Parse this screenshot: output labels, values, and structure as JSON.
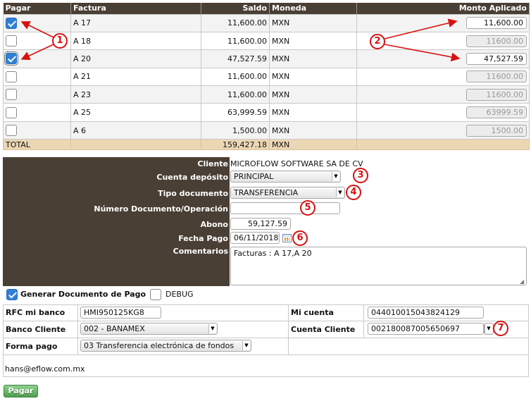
{
  "table": {
    "headers": {
      "pay": "Pagar",
      "invoice": "Factura",
      "balance": "Saldo",
      "currency": "Moneda",
      "amount": "Monto Aplicado"
    },
    "rows": [
      {
        "checked": true,
        "invoice": "A 17",
        "balance": "11,600.00",
        "currency": "MXN",
        "amount": "11,600.00",
        "enabled": true
      },
      {
        "checked": false,
        "invoice": "A 18",
        "balance": "11,600.00",
        "currency": "MXN",
        "amount": "11600.00",
        "enabled": false
      },
      {
        "checked": true,
        "invoice": "A 20",
        "balance": "47,527.59",
        "currency": "MXN",
        "amount": "47,527.59",
        "enabled": true
      },
      {
        "checked": false,
        "invoice": "A 21",
        "balance": "11,600.00",
        "currency": "MXN",
        "amount": "11600.00",
        "enabled": false
      },
      {
        "checked": false,
        "invoice": "A 23",
        "balance": "11,600.00",
        "currency": "MXN",
        "amount": "11600.00",
        "enabled": false
      },
      {
        "checked": false,
        "invoice": "A 25",
        "balance": "63,999.59",
        "currency": "MXN",
        "amount": "63999.59",
        "enabled": false
      },
      {
        "checked": false,
        "invoice": "A 6",
        "balance": "1,500.00",
        "currency": "MXN",
        "amount": "1500.00",
        "enabled": false
      }
    ],
    "total": {
      "label": "TOTAL",
      "balance": "159,427.18",
      "currency": "MXN"
    }
  },
  "form": {
    "client_label": "Cliente",
    "client_value": "MICROFLOW SOFTWARE SA DE CV",
    "deposit_account_label": "Cuenta depósito",
    "deposit_account_value": "PRINCIPAL",
    "doc_type_label": "Tipo documento",
    "doc_type_value": "TRANSFERENCIA",
    "doc_number_label": "Número Documento/Operación",
    "doc_number_value": "",
    "payment_label": "Abono",
    "payment_value": "59,127.59",
    "pay_date_label": "Fecha Pago",
    "pay_date_value": "06/11/2018",
    "comments_label": "Comentarios",
    "comments_value": "Facturas : A 17,A 20"
  },
  "options": {
    "generate_doc_label": "Generar Documento de Pago",
    "generate_doc_checked": true,
    "debug_label": "DEBUG",
    "debug_checked": false
  },
  "bank": {
    "rfc_label": "RFC mi banco",
    "rfc_value": "HMI950125KG8",
    "my_account_label": "Mi cuenta",
    "my_account_value": "044010015043824129",
    "client_bank_label": "Banco Cliente",
    "client_bank_value": "002 - BANAMEX",
    "client_account_label": "Cuenta Cliente",
    "client_account_value": "002180087005650697",
    "payment_method_label": "Forma pago",
    "payment_method_value": "03 Transferencia electrónica de fondos",
    "email": "hans@eflow.com.mx"
  },
  "actions": {
    "pay_button": "Pagar"
  },
  "annotations": [
    "1",
    "2",
    "3",
    "4",
    "5",
    "6",
    "7"
  ],
  "colors": {
    "header_bg": "#4a3f35",
    "total_bg": "#ecd7b5",
    "checkbox_blue": "#2f7fd6",
    "annotation_red": "#d81010",
    "button_green": "#5aa75a"
  }
}
